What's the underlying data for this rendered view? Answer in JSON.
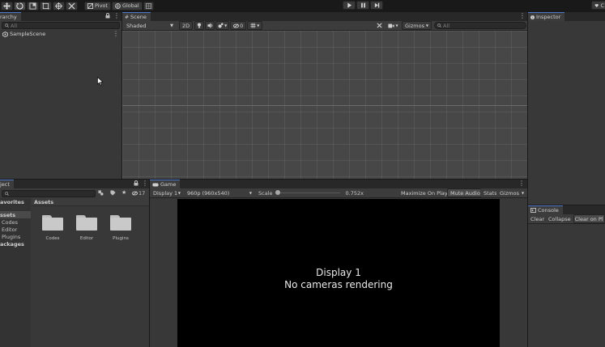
{
  "top_toolbar": {
    "pivot_label": "Pivot",
    "global_label": "Global",
    "account_label": "C"
  },
  "hierarchy": {
    "tab_label": "rarchy",
    "search_placeholder": "All",
    "scene_item": "SampleScene"
  },
  "scene": {
    "tab_label": "Scene",
    "draw_mode": "Shaded",
    "mode_2d": "2D",
    "layer_count": "0",
    "gizmos_label": "Gizmos",
    "search_placeholder": "All"
  },
  "inspector": {
    "tab_label": "Inspector"
  },
  "project": {
    "tab_label": "ject",
    "hidden_count": "17",
    "favorites_label": "avorites",
    "tree": [
      {
        "label": "ssets",
        "selected": true
      },
      {
        "label": "Codes",
        "selected": false
      },
      {
        "label": "Editor",
        "selected": false
      },
      {
        "label": "Plugins",
        "selected": false
      },
      {
        "label": "ackages",
        "selected": false
      }
    ],
    "breadcrumb": "Assets",
    "folders": [
      {
        "label": "Codes"
      },
      {
        "label": "Editor"
      },
      {
        "label": "Plugins"
      }
    ]
  },
  "game": {
    "tab_label": "Game",
    "display_label": "Display 1",
    "resolution_label": "960p (960x540)",
    "scale_label": "Scale",
    "scale_value": "0.752x",
    "maximize_label": "Maximize On Play",
    "mute_label": "Mute Audio",
    "stats_label": "Stats",
    "gizmos_label": "Gizmos",
    "message_line1": "Display 1",
    "message_line2": "No cameras rendering"
  },
  "console": {
    "tab_label": "Console",
    "clear_label": "Clear",
    "collapse_label": "Collapse",
    "clear_on_play_label": "Clear on Pl"
  },
  "colors": {
    "accent": "#4d78cc",
    "scene_bg": "#474747",
    "panel_bg": "#383838",
    "game_bg": "#000000"
  }
}
